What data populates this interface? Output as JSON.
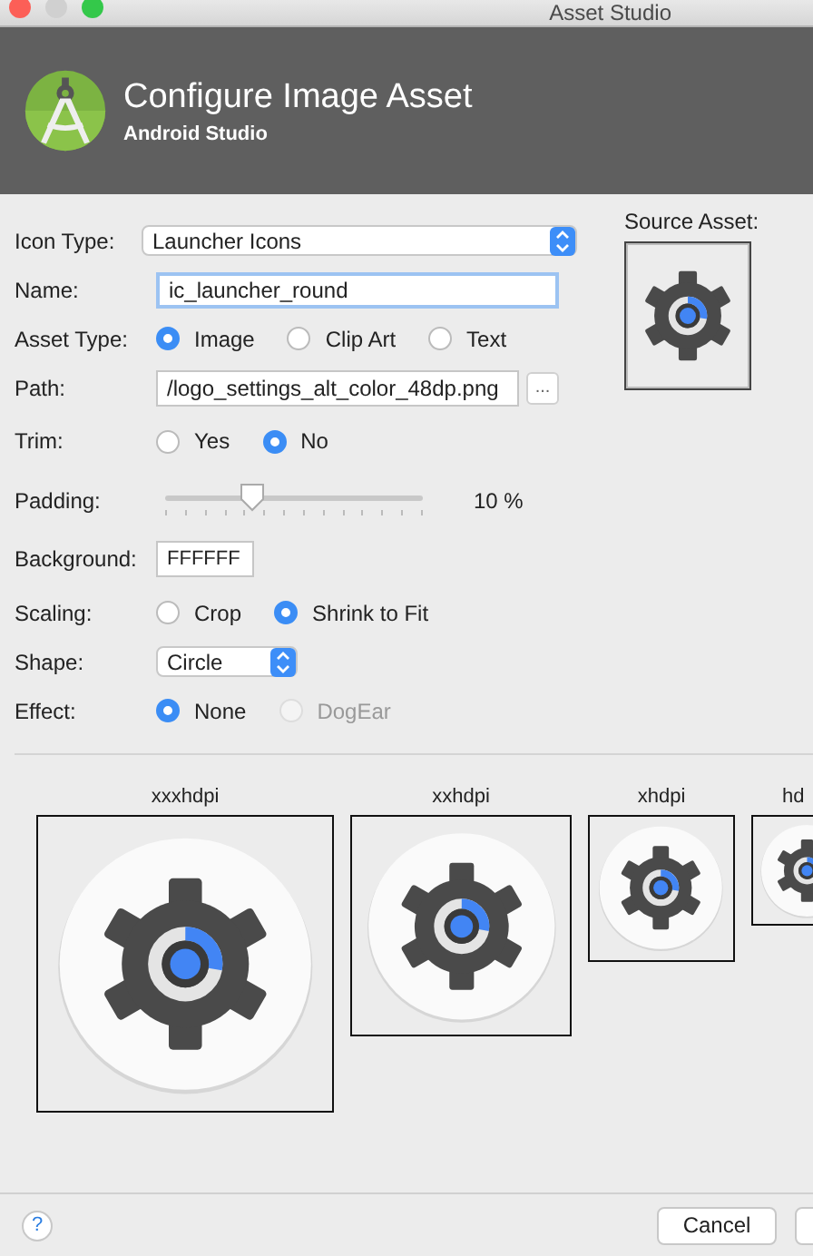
{
  "window": {
    "title": "Asset Studio"
  },
  "header": {
    "title": "Configure Image Asset",
    "subtitle": "Android Studio"
  },
  "fields": [
    {
      "kind": "dropdown",
      "label": "Icon Type:",
      "value": "Launcher Icons"
    },
    {
      "kind": "text",
      "label": "Name:",
      "value": "ic_launcher_round",
      "focused": true
    },
    {
      "kind": "radio",
      "label": "Asset Type:",
      "options": [
        {
          "label": "Image",
          "selected": true,
          "disabled": false
        },
        {
          "label": "Clip Art",
          "selected": false,
          "disabled": false
        },
        {
          "label": "Text",
          "selected": false,
          "disabled": false
        }
      ]
    },
    {
      "kind": "path",
      "label": "Path:",
      "value": "/logo_settings_alt_color_48dp.png",
      "button": "..."
    },
    {
      "kind": "radio",
      "label": "Trim:",
      "options": [
        {
          "label": "Yes",
          "selected": false,
          "disabled": false
        },
        {
          "label": "No",
          "selected": true,
          "disabled": false
        }
      ]
    },
    {
      "kind": "slider",
      "label": "Padding:",
      "level": 0.34,
      "reading": "10 %"
    },
    {
      "kind": "color",
      "label": "Background:",
      "value": "FFFFFF"
    },
    {
      "kind": "radio",
      "label": "Scaling:",
      "options": [
        {
          "label": "Crop",
          "selected": false,
          "disabled": false
        },
        {
          "label": "Shrink to Fit",
          "selected": true,
          "disabled": false
        }
      ]
    },
    {
      "kind": "dropdown",
      "label": "Shape:",
      "value": "Circle"
    },
    {
      "kind": "radio",
      "label": "Effect:",
      "options": [
        {
          "label": "None",
          "selected": true,
          "disabled": false
        },
        {
          "label": "DogEar",
          "selected": false,
          "disabled": true
        }
      ]
    }
  ],
  "source_asset": {
    "label": "Source Asset:"
  },
  "previews": [
    {
      "label": "xxxhdpi"
    },
    {
      "label": "xxhdpi"
    },
    {
      "label": "xhdpi"
    },
    {
      "label": "hd"
    }
  ],
  "footer": {
    "help": "?",
    "buttons": [
      "Cancel"
    ]
  }
}
